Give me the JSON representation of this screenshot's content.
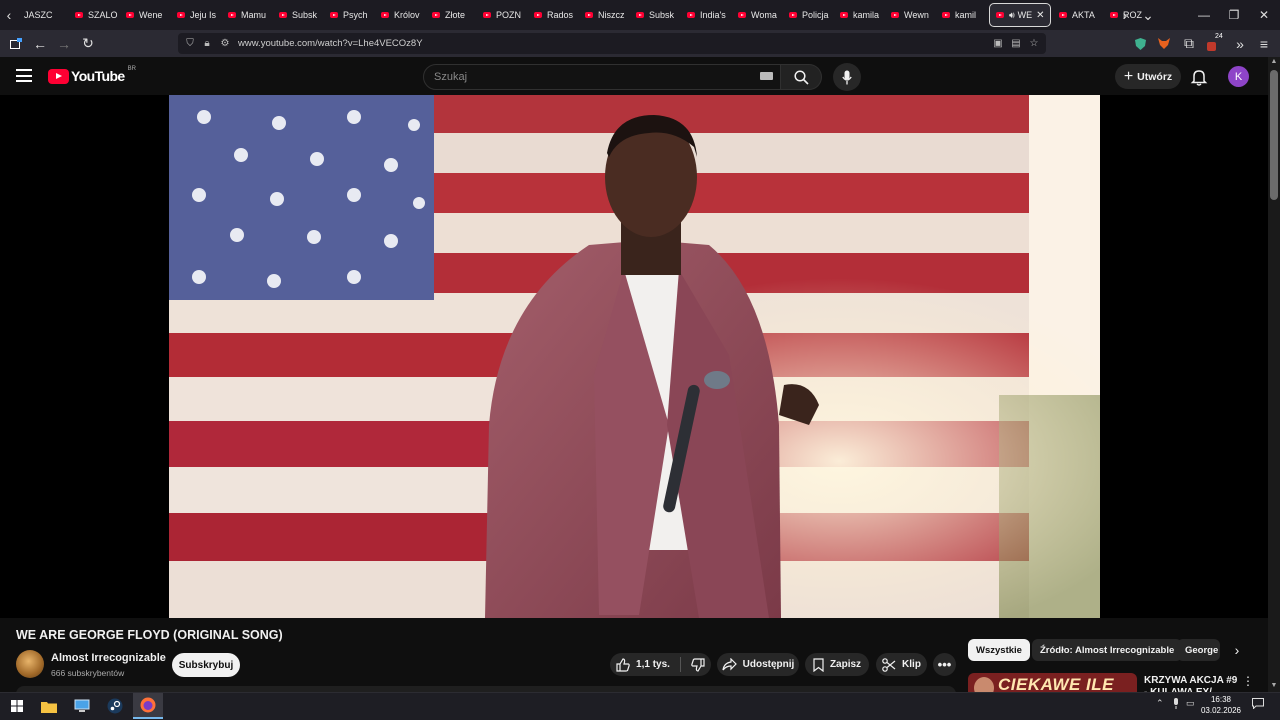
{
  "browser": {
    "tabs": [
      {
        "label": "JASZC",
        "favicon": "none"
      },
      {
        "label": "SZALO",
        "favicon": "youtube-icon"
      },
      {
        "label": "Wene",
        "favicon": "youtube-icon"
      },
      {
        "label": "Jeju Is",
        "favicon": "youtube-icon"
      },
      {
        "label": "Mamu",
        "favicon": "youtube-icon"
      },
      {
        "label": "Subsk",
        "favicon": "youtube-icon"
      },
      {
        "label": "Psych",
        "favicon": "youtube-icon"
      },
      {
        "label": "Królov",
        "favicon": "youtube-icon"
      },
      {
        "label": "Złote",
        "favicon": "youtube-icon"
      },
      {
        "label": "POZN",
        "favicon": "youtube-icon"
      },
      {
        "label": "Rados",
        "favicon": "youtube-icon"
      },
      {
        "label": "Niszcz",
        "favicon": "youtube-icon"
      },
      {
        "label": "Subsk",
        "favicon": "youtube-icon"
      },
      {
        "label": "India's",
        "favicon": "youtube-icon"
      },
      {
        "label": "Woma",
        "favicon": "youtube-icon"
      },
      {
        "label": "Policja",
        "favicon": "youtube-icon"
      },
      {
        "label": "kamila",
        "favicon": "youtube-icon"
      },
      {
        "label": "Wewn",
        "favicon": "youtube-icon"
      },
      {
        "label": "kamil",
        "favicon": "youtube-icon"
      }
    ],
    "active_tab": {
      "label": "WE",
      "audio": true
    },
    "tabs_after": [
      {
        "label": "AKTA",
        "favicon": "youtube-icon"
      },
      {
        "label": "ROZ",
        "favicon": "youtube-icon"
      }
    ],
    "url": "www.youtube.com/watch?v=Lhe4VECOz8Y",
    "extension_badge": "24"
  },
  "youtube": {
    "logo_text": "YouTube",
    "country_code": "BR",
    "search_placeholder": "Szukaj",
    "create_label": "Utwórz",
    "avatar_letter": "K",
    "accent_red": "#ff0033"
  },
  "video": {
    "title": "WE ARE GEORGE FLOYD (ORIGINAL SONG)",
    "channel_name": "Almost Irrecognizable",
    "subscribers": "666 subskrybentów",
    "subscribe_label": "Subskrybuj",
    "likes": "1,1 tys.",
    "share_label": "Udostępnij",
    "save_label": "Zapisz",
    "clip_label": "Klip"
  },
  "sidebar": {
    "chips": [
      "Wszystkie",
      "Źródło: Almost Irrecognizable",
      "George"
    ],
    "recommendation": {
      "title": "KRZYWA AKCJA #9 - KULAWA EX/",
      "thumb_text": "CIEKAWE ILE"
    }
  },
  "taskbar": {
    "time": "16:38",
    "date": "03.02.2026"
  }
}
